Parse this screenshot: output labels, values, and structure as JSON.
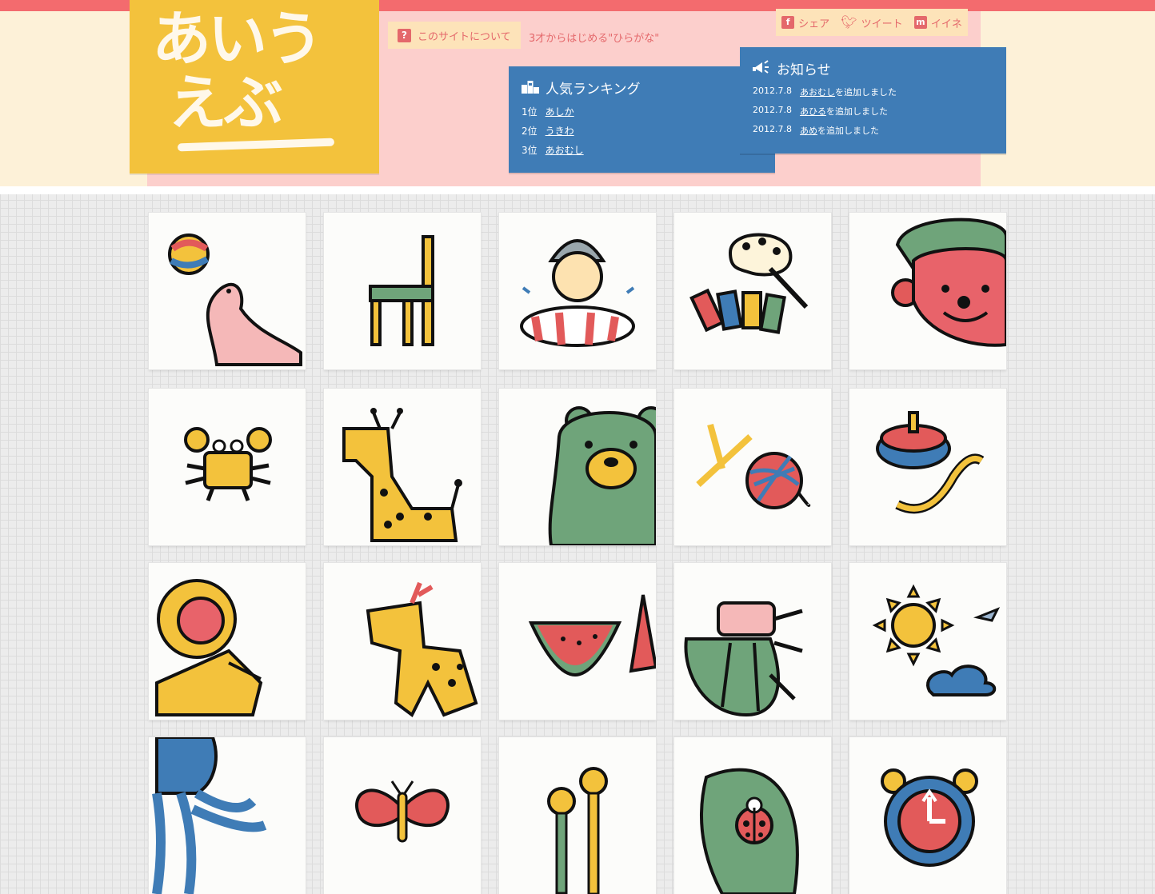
{
  "site": {
    "logo_line1": "あいう",
    "logo_line2": "えぶ",
    "about_label": "このサイトについて",
    "tagline": "3才からはじめる\"ひらがな\""
  },
  "social": {
    "share": "シェア",
    "tweet": "ツイート",
    "like": "イイネ"
  },
  "ranking": {
    "title": "人気ランキング",
    "items": [
      {
        "rank": "1位",
        "word": "あしか"
      },
      {
        "rank": "2位",
        "word": "うきわ"
      },
      {
        "rank": "3位",
        "word": "あおむし"
      }
    ]
  },
  "news": {
    "title": "お知らせ",
    "items": [
      {
        "date": "2012.7.8",
        "word": "あおむし",
        "suffix": "を追加しました"
      },
      {
        "date": "2012.7.8",
        "word": "あひる",
        "suffix": "を追加しました"
      },
      {
        "date": "2012.7.8",
        "word": "あめ",
        "suffix": "を追加しました"
      }
    ]
  },
  "colors": {
    "accent_red": "#f36b6e",
    "logo_yellow": "#f3c23c",
    "panel_blue": "#3f7cb6",
    "header_pink": "#fccfcc",
    "header_cream": "#fdf1d8"
  },
  "tiles": [
    {
      "name": "tile-seal-ball"
    },
    {
      "name": "tile-chair"
    },
    {
      "name": "tile-boy-swim-ring"
    },
    {
      "name": "tile-paint-palette"
    },
    {
      "name": "tile-red-face"
    },
    {
      "name": "tile-crab"
    },
    {
      "name": "tile-giraffe"
    },
    {
      "name": "tile-bear"
    },
    {
      "name": "tile-knitting-yarn"
    },
    {
      "name": "tile-spinning-top"
    },
    {
      "name": "tile-monkey"
    },
    {
      "name": "tile-deer"
    },
    {
      "name": "tile-watermelon"
    },
    {
      "name": "tile-beetle"
    },
    {
      "name": "tile-sun-cloud"
    },
    {
      "name": "tile-octopus"
    },
    {
      "name": "tile-butterfly"
    },
    {
      "name": "tile-maracas"
    },
    {
      "name": "tile-ladybug-leaf"
    },
    {
      "name": "tile-alarm-clock"
    }
  ]
}
